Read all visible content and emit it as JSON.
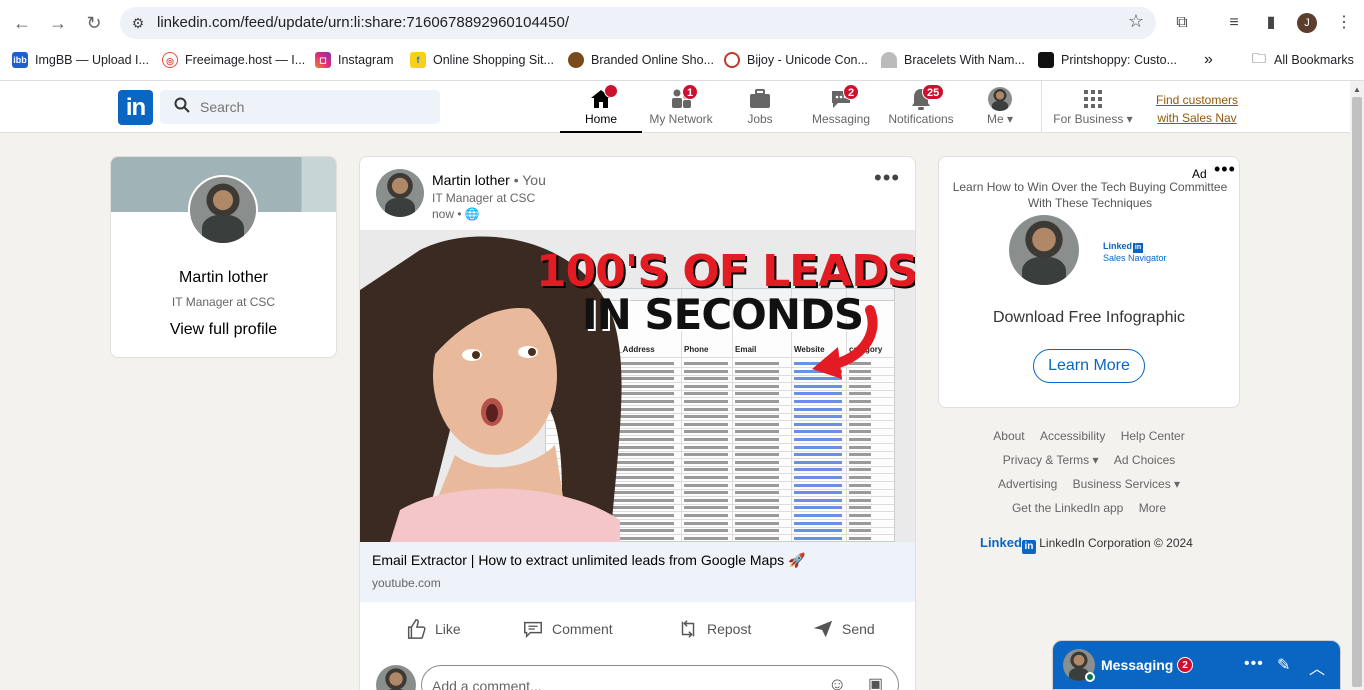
{
  "browser": {
    "url": "linkedin.com/feed/update/urn:li:share:7160678892960104450/",
    "profile_initial": "J",
    "bookmarks": [
      {
        "label": "ImgBB — Upload I...",
        "icon": "imgbb-icon",
        "color": "#1d5fd1"
      },
      {
        "label": "Freeimage.host — I...",
        "icon": "freeimage-icon",
        "color": "#e74c3c"
      },
      {
        "label": "Instagram",
        "icon": "instagram-icon",
        "color": "#d6249f"
      },
      {
        "label": "Online Shopping Sit...",
        "icon": "flipkart-icon",
        "color": "#2874f0"
      },
      {
        "label": "Branded Online Sho...",
        "icon": "shop-icon",
        "color": "#7a4a1c"
      },
      {
        "label": "Bijoy - Unicode Con...",
        "icon": "bijoy-icon",
        "color": "#c0392b"
      },
      {
        "label": "Bracelets With Nam...",
        "icon": "bracelet-icon",
        "color": "#888888"
      },
      {
        "label": "Printshoppy: Custo...",
        "icon": "printshoppy-icon",
        "color": "#111111"
      }
    ],
    "overflow": "»",
    "all_bookmarks": "All Bookmarks"
  },
  "header": {
    "logo": "in",
    "search_placeholder": "Search",
    "nav": [
      {
        "label": "Home",
        "badge": ""
      },
      {
        "label": "My Network",
        "badge": "1"
      },
      {
        "label": "Jobs",
        "badge": ""
      },
      {
        "label": "Messaging",
        "badge": "2"
      },
      {
        "label": "Notifications",
        "badge": "25"
      },
      {
        "label": "Me",
        "badge": ""
      },
      {
        "label": "For Business",
        "badge": ""
      }
    ],
    "find_customers": "Find customers with Sales Nav"
  },
  "profile": {
    "name": "Martin lother",
    "title": "IT Manager at CSC",
    "view_profile": "View full profile"
  },
  "post": {
    "author": "Martin lother",
    "you": "• You",
    "subtitle": "IT Manager at CSC",
    "time": "now •",
    "image_headline_1": "100'S OF LEADS",
    "image_headline_2": "IN SECONDS",
    "sheet_headers": [
      "Full_Address",
      "Phone",
      "Email",
      "Website",
      "category"
    ],
    "link_title": "Email Extractor | How to extract unlimited leads from Google Maps 🚀",
    "link_source": "youtube.com",
    "actions": [
      "Like",
      "Comment",
      "Repost",
      "Send"
    ],
    "comment_placeholder": "Add a comment..."
  },
  "ad": {
    "label": "Ad",
    "text": "Learn How to Win Over the Tech Buying Committee With These Techniques",
    "brand_line1": "Linked",
    "brand_line2": "Sales Navigator",
    "cta_text": "Download Free Infographic",
    "button": "Learn More"
  },
  "footer": {
    "row1": [
      "About",
      "Accessibility",
      "Help Center"
    ],
    "row2": [
      "Privacy & Terms ▾",
      "Ad Choices"
    ],
    "row3": [
      "Advertising",
      "Business Services ▾"
    ],
    "row4": [
      "Get the LinkedIn app",
      "More"
    ],
    "corp_brand": "Linked",
    "corp_text": "LinkedIn Corporation © 2024"
  },
  "messaging_bar": {
    "label": "Messaging",
    "badge": "2"
  }
}
